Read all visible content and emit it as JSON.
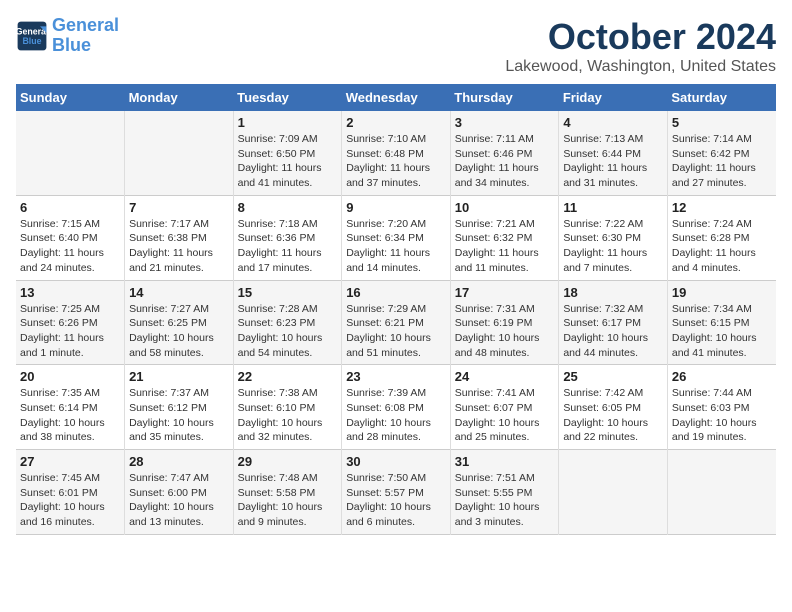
{
  "header": {
    "logo_line1": "General",
    "logo_line2": "Blue",
    "month": "October 2024",
    "location": "Lakewood, Washington, United States"
  },
  "weekdays": [
    "Sunday",
    "Monday",
    "Tuesday",
    "Wednesday",
    "Thursday",
    "Friday",
    "Saturday"
  ],
  "weeks": [
    [
      {
        "day": "",
        "sunrise": "",
        "sunset": "",
        "daylight": ""
      },
      {
        "day": "",
        "sunrise": "",
        "sunset": "",
        "daylight": ""
      },
      {
        "day": "1",
        "sunrise": "Sunrise: 7:09 AM",
        "sunset": "Sunset: 6:50 PM",
        "daylight": "Daylight: 11 hours and 41 minutes."
      },
      {
        "day": "2",
        "sunrise": "Sunrise: 7:10 AM",
        "sunset": "Sunset: 6:48 PM",
        "daylight": "Daylight: 11 hours and 37 minutes."
      },
      {
        "day": "3",
        "sunrise": "Sunrise: 7:11 AM",
        "sunset": "Sunset: 6:46 PM",
        "daylight": "Daylight: 11 hours and 34 minutes."
      },
      {
        "day": "4",
        "sunrise": "Sunrise: 7:13 AM",
        "sunset": "Sunset: 6:44 PM",
        "daylight": "Daylight: 11 hours and 31 minutes."
      },
      {
        "day": "5",
        "sunrise": "Sunrise: 7:14 AM",
        "sunset": "Sunset: 6:42 PM",
        "daylight": "Daylight: 11 hours and 27 minutes."
      }
    ],
    [
      {
        "day": "6",
        "sunrise": "Sunrise: 7:15 AM",
        "sunset": "Sunset: 6:40 PM",
        "daylight": "Daylight: 11 hours and 24 minutes."
      },
      {
        "day": "7",
        "sunrise": "Sunrise: 7:17 AM",
        "sunset": "Sunset: 6:38 PM",
        "daylight": "Daylight: 11 hours and 21 minutes."
      },
      {
        "day": "8",
        "sunrise": "Sunrise: 7:18 AM",
        "sunset": "Sunset: 6:36 PM",
        "daylight": "Daylight: 11 hours and 17 minutes."
      },
      {
        "day": "9",
        "sunrise": "Sunrise: 7:20 AM",
        "sunset": "Sunset: 6:34 PM",
        "daylight": "Daylight: 11 hours and 14 minutes."
      },
      {
        "day": "10",
        "sunrise": "Sunrise: 7:21 AM",
        "sunset": "Sunset: 6:32 PM",
        "daylight": "Daylight: 11 hours and 11 minutes."
      },
      {
        "day": "11",
        "sunrise": "Sunrise: 7:22 AM",
        "sunset": "Sunset: 6:30 PM",
        "daylight": "Daylight: 11 hours and 7 minutes."
      },
      {
        "day": "12",
        "sunrise": "Sunrise: 7:24 AM",
        "sunset": "Sunset: 6:28 PM",
        "daylight": "Daylight: 11 hours and 4 minutes."
      }
    ],
    [
      {
        "day": "13",
        "sunrise": "Sunrise: 7:25 AM",
        "sunset": "Sunset: 6:26 PM",
        "daylight": "Daylight: 11 hours and 1 minute."
      },
      {
        "day": "14",
        "sunrise": "Sunrise: 7:27 AM",
        "sunset": "Sunset: 6:25 PM",
        "daylight": "Daylight: 10 hours and 58 minutes."
      },
      {
        "day": "15",
        "sunrise": "Sunrise: 7:28 AM",
        "sunset": "Sunset: 6:23 PM",
        "daylight": "Daylight: 10 hours and 54 minutes."
      },
      {
        "day": "16",
        "sunrise": "Sunrise: 7:29 AM",
        "sunset": "Sunset: 6:21 PM",
        "daylight": "Daylight: 10 hours and 51 minutes."
      },
      {
        "day": "17",
        "sunrise": "Sunrise: 7:31 AM",
        "sunset": "Sunset: 6:19 PM",
        "daylight": "Daylight: 10 hours and 48 minutes."
      },
      {
        "day": "18",
        "sunrise": "Sunrise: 7:32 AM",
        "sunset": "Sunset: 6:17 PM",
        "daylight": "Daylight: 10 hours and 44 minutes."
      },
      {
        "day": "19",
        "sunrise": "Sunrise: 7:34 AM",
        "sunset": "Sunset: 6:15 PM",
        "daylight": "Daylight: 10 hours and 41 minutes."
      }
    ],
    [
      {
        "day": "20",
        "sunrise": "Sunrise: 7:35 AM",
        "sunset": "Sunset: 6:14 PM",
        "daylight": "Daylight: 10 hours and 38 minutes."
      },
      {
        "day": "21",
        "sunrise": "Sunrise: 7:37 AM",
        "sunset": "Sunset: 6:12 PM",
        "daylight": "Daylight: 10 hours and 35 minutes."
      },
      {
        "day": "22",
        "sunrise": "Sunrise: 7:38 AM",
        "sunset": "Sunset: 6:10 PM",
        "daylight": "Daylight: 10 hours and 32 minutes."
      },
      {
        "day": "23",
        "sunrise": "Sunrise: 7:39 AM",
        "sunset": "Sunset: 6:08 PM",
        "daylight": "Daylight: 10 hours and 28 minutes."
      },
      {
        "day": "24",
        "sunrise": "Sunrise: 7:41 AM",
        "sunset": "Sunset: 6:07 PM",
        "daylight": "Daylight: 10 hours and 25 minutes."
      },
      {
        "day": "25",
        "sunrise": "Sunrise: 7:42 AM",
        "sunset": "Sunset: 6:05 PM",
        "daylight": "Daylight: 10 hours and 22 minutes."
      },
      {
        "day": "26",
        "sunrise": "Sunrise: 7:44 AM",
        "sunset": "Sunset: 6:03 PM",
        "daylight": "Daylight: 10 hours and 19 minutes."
      }
    ],
    [
      {
        "day": "27",
        "sunrise": "Sunrise: 7:45 AM",
        "sunset": "Sunset: 6:01 PM",
        "daylight": "Daylight: 10 hours and 16 minutes."
      },
      {
        "day": "28",
        "sunrise": "Sunrise: 7:47 AM",
        "sunset": "Sunset: 6:00 PM",
        "daylight": "Daylight: 10 hours and 13 minutes."
      },
      {
        "day": "29",
        "sunrise": "Sunrise: 7:48 AM",
        "sunset": "Sunset: 5:58 PM",
        "daylight": "Daylight: 10 hours and 9 minutes."
      },
      {
        "day": "30",
        "sunrise": "Sunrise: 7:50 AM",
        "sunset": "Sunset: 5:57 PM",
        "daylight": "Daylight: 10 hours and 6 minutes."
      },
      {
        "day": "31",
        "sunrise": "Sunrise: 7:51 AM",
        "sunset": "Sunset: 5:55 PM",
        "daylight": "Daylight: 10 hours and 3 minutes."
      },
      {
        "day": "",
        "sunrise": "",
        "sunset": "",
        "daylight": ""
      },
      {
        "day": "",
        "sunrise": "",
        "sunset": "",
        "daylight": ""
      }
    ]
  ]
}
